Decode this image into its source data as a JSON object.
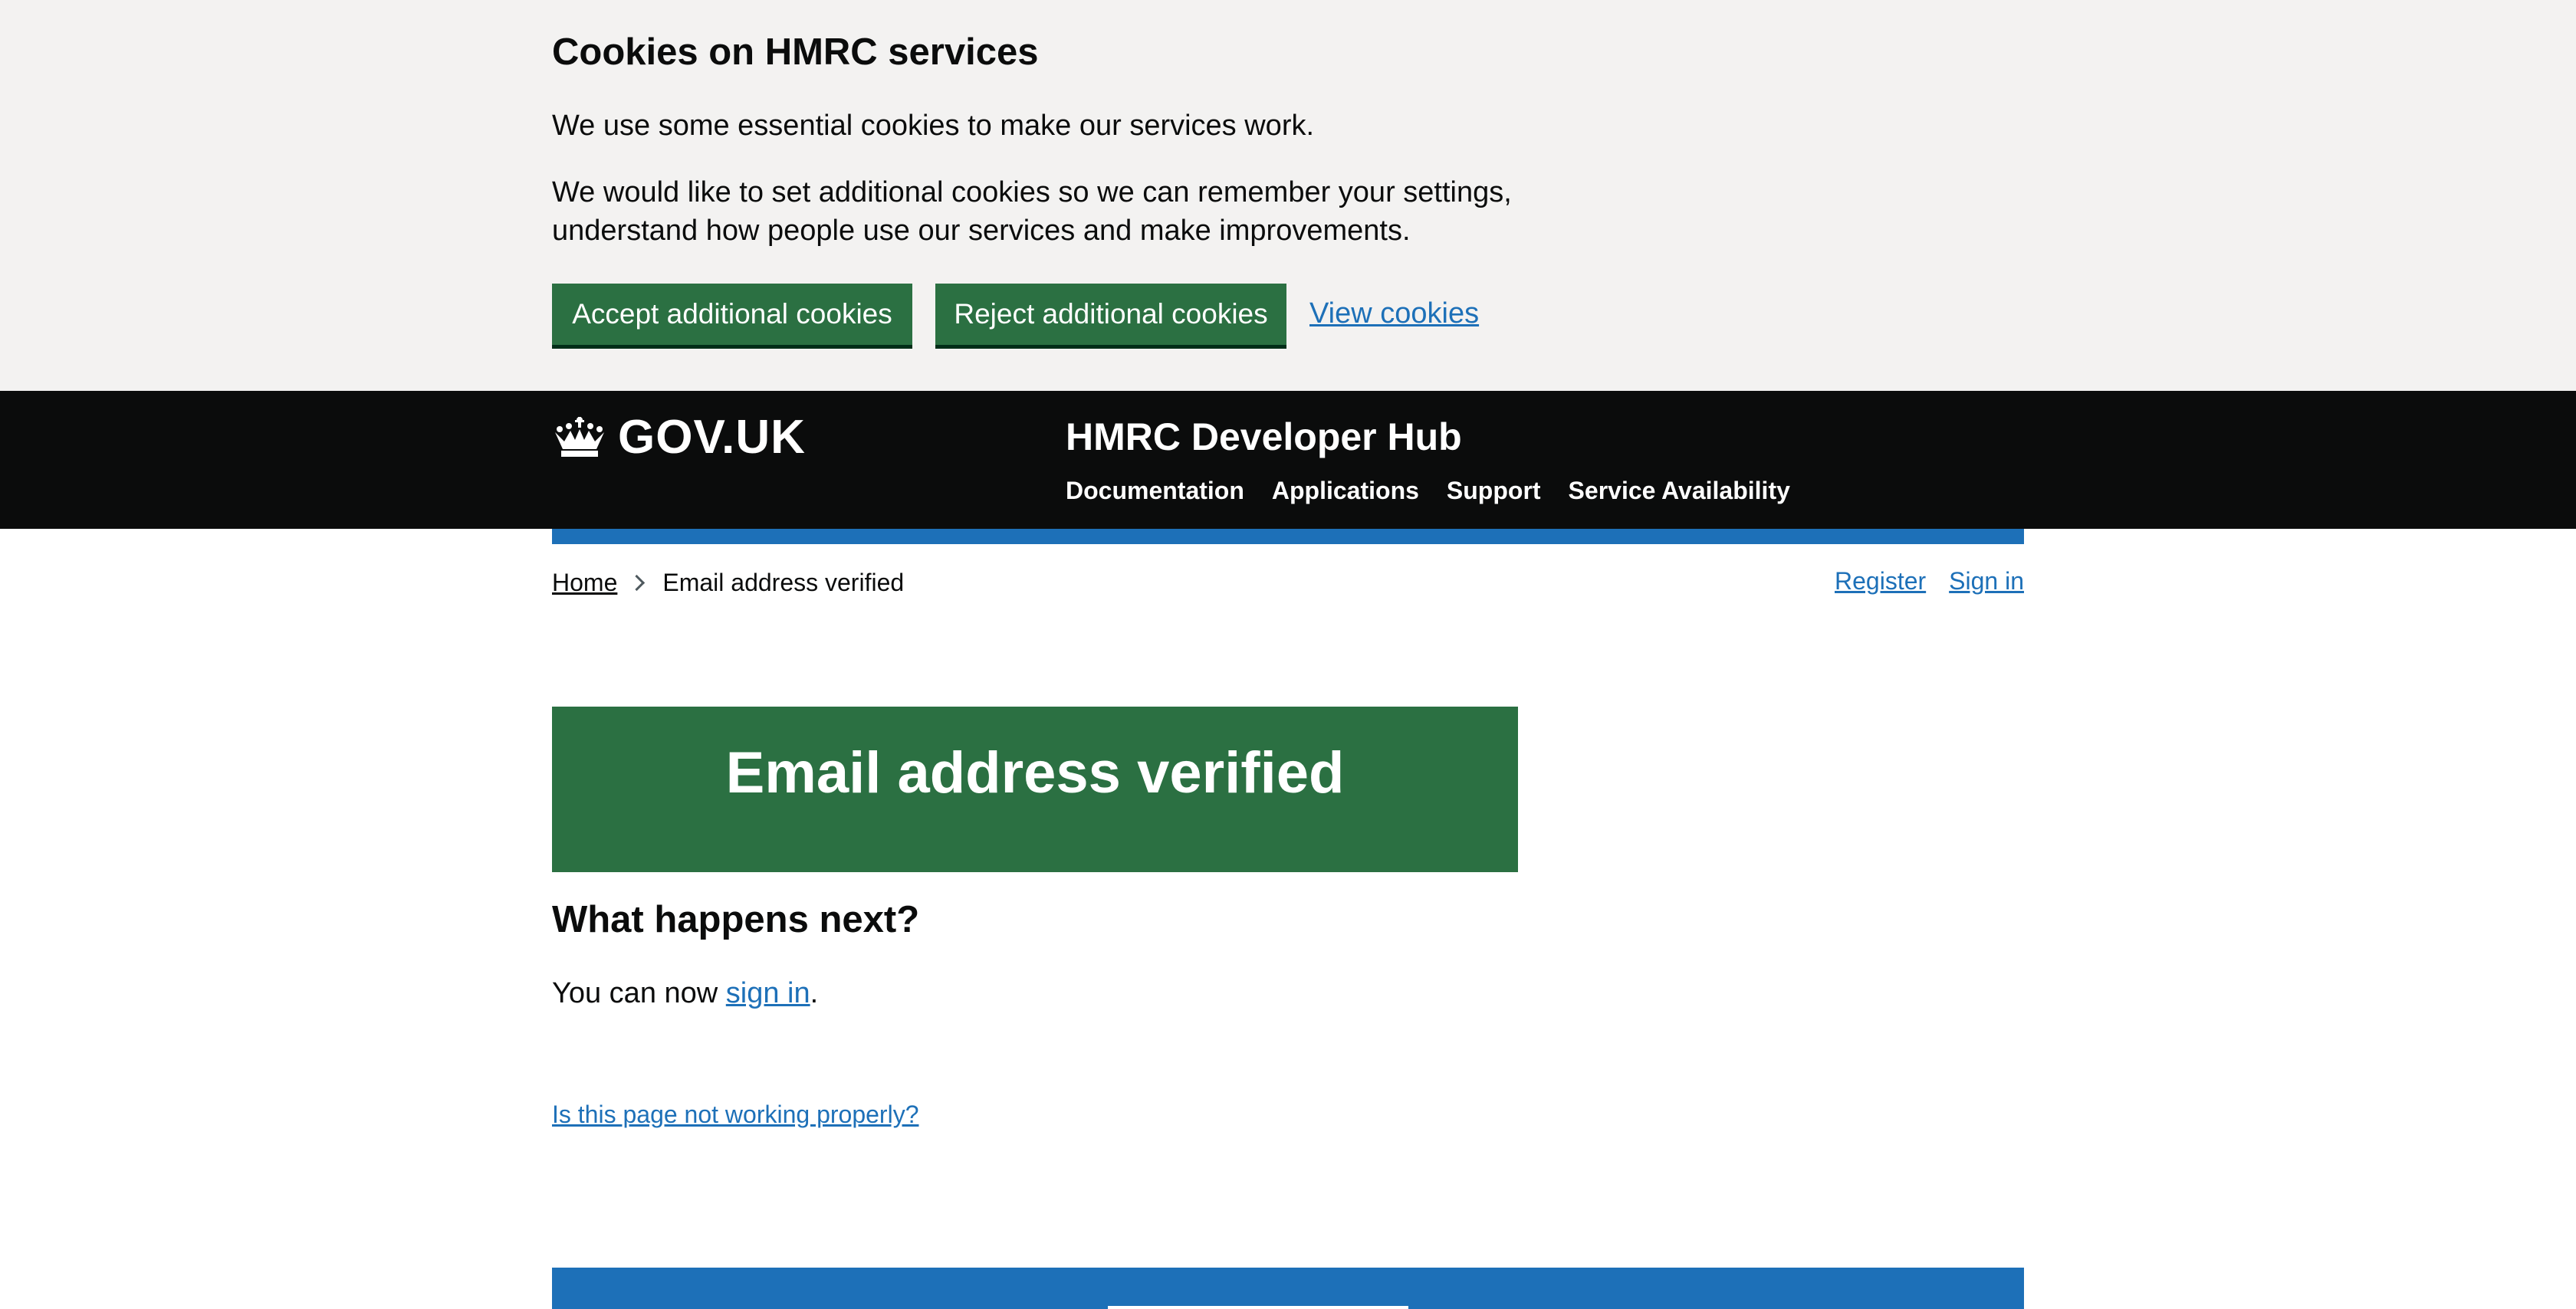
{
  "cookie_banner": {
    "title": "Cookies on HMRC services",
    "para1": "We use some essential cookies to make our services work.",
    "para2": "We would like to set additional cookies so we can remember your settings, understand how people use our services and make improvements.",
    "accept_label": "Accept additional cookies",
    "reject_label": "Reject additional cookies",
    "view_label": "View cookies"
  },
  "header": {
    "logo_text": "GOV.UK",
    "service_name": "HMRC Developer Hub",
    "nav": [
      "Documentation",
      "Applications",
      "Support",
      "Service Availability"
    ]
  },
  "breadcrumb": {
    "items": [
      "Home",
      "Email address verified"
    ]
  },
  "account": {
    "register": "Register",
    "sign_in": "Sign in"
  },
  "panel": {
    "title": "Email address verified"
  },
  "next": {
    "heading": "What happens next?",
    "text_before": "You can now ",
    "link": "sign in",
    "text_after": "."
  },
  "report_link": "Is this page not working properly?",
  "colors": {
    "cookie_bg": "#f3f2f1",
    "header_bg": "#0b0c0c",
    "brand_blue": "#1d70b8",
    "button_green": "#2b7042",
    "link": "#1d70b8"
  },
  "icons": {
    "logo": "crown-icon",
    "breadcrumb_separator": "chevron-right-icon"
  }
}
